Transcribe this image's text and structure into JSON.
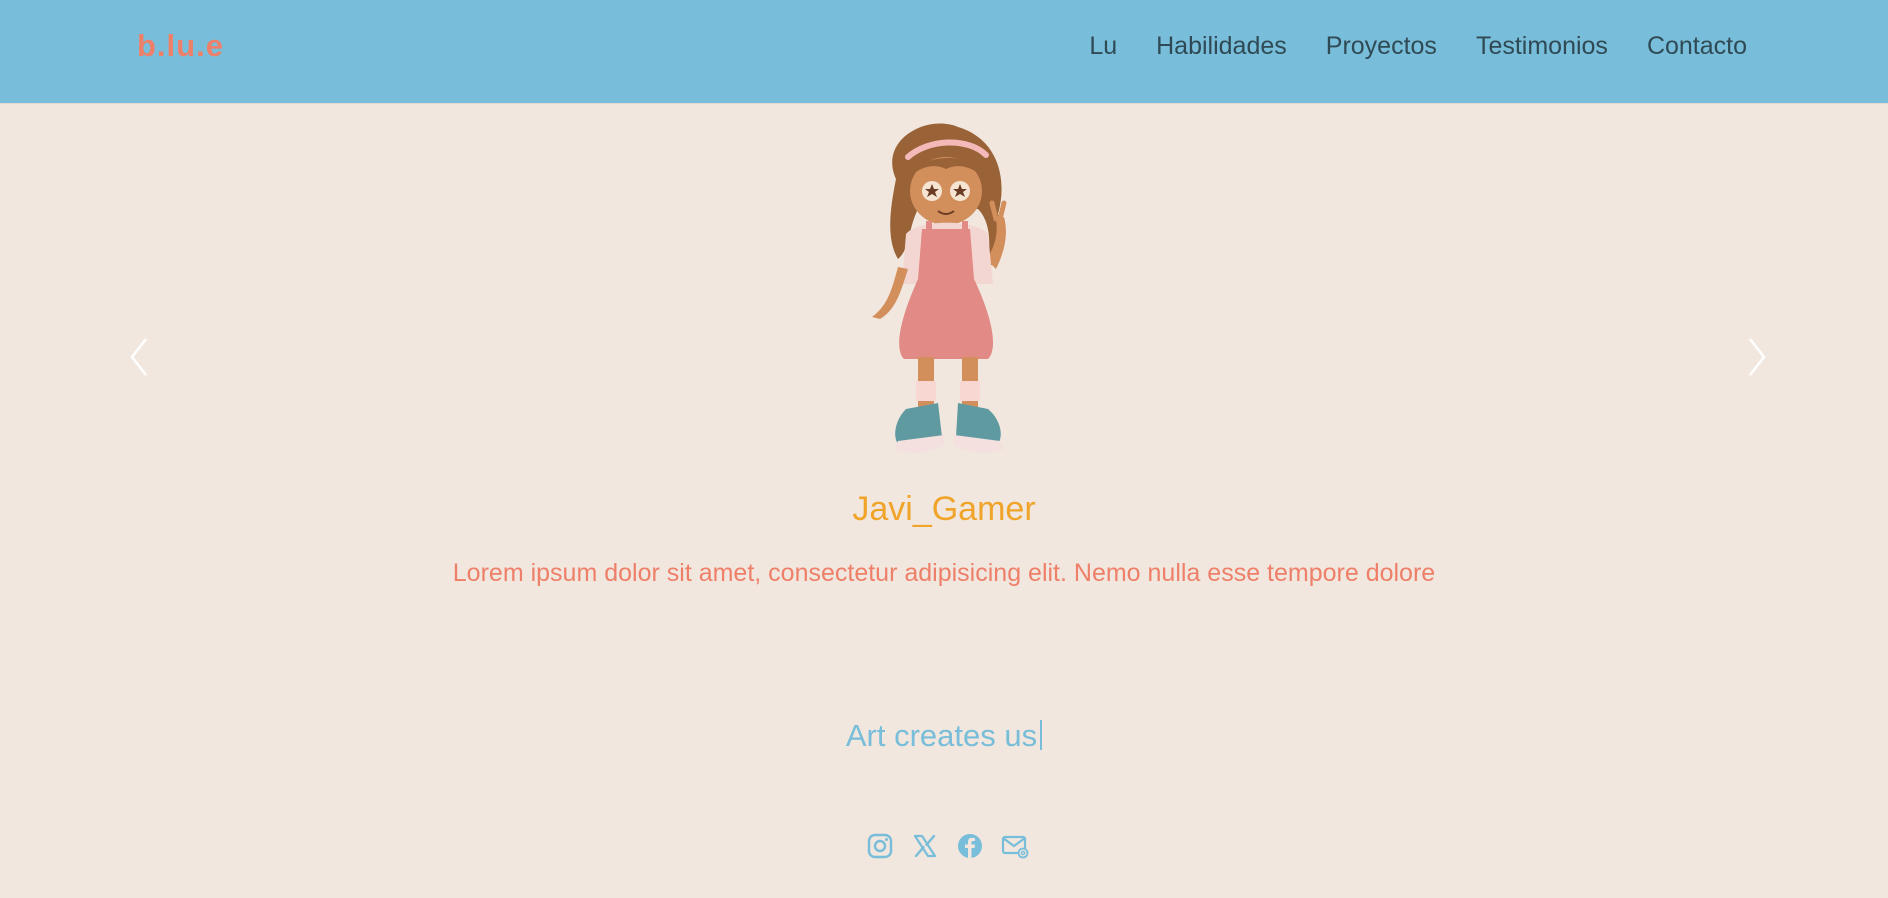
{
  "brand": {
    "logo": "b.lu.e"
  },
  "nav": {
    "items": [
      "Lu",
      "Habilidades",
      "Proyectos",
      "Testimonios",
      "Contacto"
    ]
  },
  "carousel": {
    "slide": {
      "name": "Javi_Gamer",
      "text": "Lorem ipsum dolor sit amet, consectetur adipisicing elit. Nemo nulla esse tempore dolore"
    }
  },
  "tagline": "Art creates us",
  "social": {
    "icons": [
      "instagram-icon",
      "x-icon",
      "facebook-icon",
      "email-icon"
    ]
  },
  "colors": {
    "header": "#78bdd9",
    "background": "#f1e7de",
    "logo": "#ee7f69",
    "name": "#f0a42a",
    "text": "#ee7f69",
    "tagline": "#78bdd9"
  }
}
